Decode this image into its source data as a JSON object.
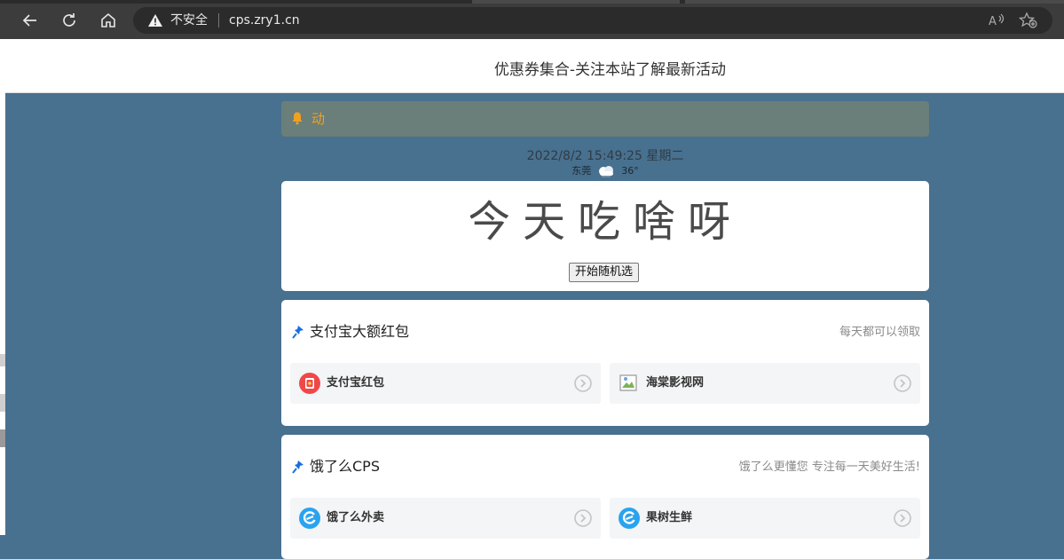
{
  "browser": {
    "security_label": "不安全",
    "url": "cps.zry1.cn",
    "icons": [
      "back-icon",
      "reload-icon",
      "home-icon",
      "warning-icon",
      "read-aloud-icon",
      "favorites-icon"
    ]
  },
  "header": {
    "title": "优惠券集合-关注本站了解最新活动"
  },
  "notice": {
    "text": "动",
    "icon": "bell-icon",
    "color": "#f0a020"
  },
  "datetime": {
    "text": "2022/8/2 15:49:25 星期二"
  },
  "weather": {
    "city": "东莞",
    "temp": "36°",
    "icon": "cloudy-icon"
  },
  "food_picker": {
    "heading": "今天吃啥呀",
    "button_label": "开始随机选"
  },
  "sections": [
    {
      "title": "支付宝大额红包",
      "subtitle": "每天都可以领取",
      "items": [
        {
          "label": "支付宝红包",
          "icon": "red-packet-icon"
        },
        {
          "label": "海棠影视网",
          "icon": "broken-image-icon"
        }
      ]
    },
    {
      "title": "饿了么CPS",
      "subtitle": "饿了么更懂您 专注每一天美好生活!",
      "items": [
        {
          "label": "饿了么外卖",
          "icon": "eleme-icon"
        },
        {
          "label": "果树生鲜",
          "icon": "eleme-icon"
        }
      ]
    }
  ],
  "colors": {
    "page_bg": "#48708f",
    "notice_bg": "#6a7e7a",
    "pin_blue": "#1a6fe0",
    "eleme_blue": "#2aa3ef",
    "alipay_red": "#f04848"
  }
}
